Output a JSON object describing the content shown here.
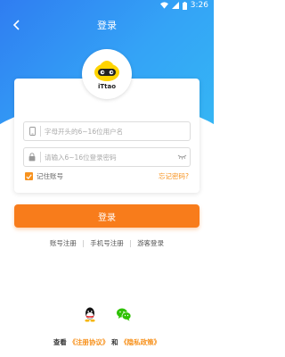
{
  "status": {
    "time": "3:26"
  },
  "header": {
    "title": "登录"
  },
  "logo": {
    "text": "iTtao"
  },
  "form": {
    "username_placeholder": "字母开头的6~16位用户名",
    "password_placeholder": "请输入6~16位登录密码",
    "remember_label": "记住账号",
    "forgot_label": "忘记密码?"
  },
  "login_button": "登录",
  "alt_login": {
    "account": "账号注册",
    "phone": "手机号注册",
    "guest": "游客登录",
    "separator": "|"
  },
  "agreement": {
    "prefix": "查看",
    "terms": "《注册协议》",
    "and": "和",
    "privacy": "《隐私政策》"
  },
  "colors": {
    "accent": "#f87c1b",
    "header_start": "#2f7df1",
    "header_end": "#35b6f4"
  }
}
